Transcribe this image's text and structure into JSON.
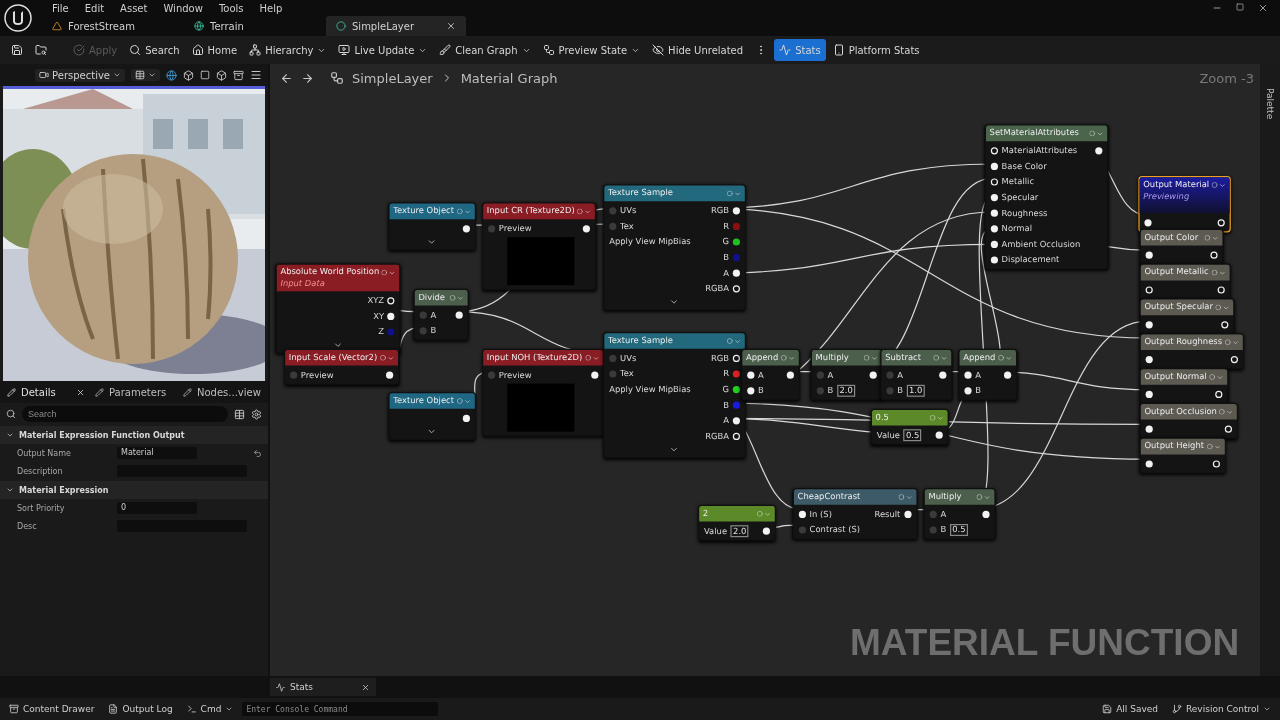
{
  "menu": [
    "File",
    "Edit",
    "Asset",
    "Window",
    "Tools",
    "Help"
  ],
  "tabs": [
    {
      "label": "ForestStream",
      "kind": "level",
      "selected": false
    },
    {
      "label": "Terrain",
      "kind": "landscape",
      "selected": false
    },
    {
      "label": "SimpleLayer",
      "kind": "material",
      "selected": true
    }
  ],
  "toolbar": [
    {
      "kind": "save",
      "disabled": false,
      "selected": false,
      "dropdown": false
    },
    {
      "kind": "browse",
      "disabled": false,
      "selected": false,
      "dropdown": false
    },
    {
      "kind": "apply",
      "label": "Apply",
      "disabled": true,
      "selected": false,
      "dropdown": false
    },
    {
      "kind": "search",
      "label": "Search",
      "disabled": false,
      "selected": false,
      "dropdown": false
    },
    {
      "kind": "home",
      "label": "Home",
      "disabled": false,
      "selected": false,
      "dropdown": false
    },
    {
      "kind": "hierarchy",
      "label": "Hierarchy",
      "disabled": false,
      "selected": false,
      "dropdown": true
    },
    {
      "kind": "live",
      "label": "Live Update",
      "disabled": false,
      "selected": false,
      "dropdown": true
    },
    {
      "kind": "clean",
      "label": "Clean Graph",
      "disabled": false,
      "selected": false,
      "dropdown": true
    },
    {
      "kind": "preview",
      "label": "Preview State",
      "disabled": false,
      "selected": false,
      "dropdown": true
    },
    {
      "kind": "hide",
      "label": "Hide Unrelated",
      "disabled": false,
      "selected": false,
      "dropdown": false
    },
    {
      "kind": "more",
      "disabled": false,
      "selected": false,
      "dropdown": false
    },
    {
      "kind": "stats",
      "label": "Stats",
      "disabled": false,
      "selected": true,
      "dropdown": false
    },
    {
      "kind": "platform",
      "label": "Platform Stats",
      "disabled": false,
      "selected": false,
      "dropdown": false
    }
  ],
  "viewport": {
    "mode": "Perspective"
  },
  "panel_tabs": [
    {
      "label": "Details",
      "selected": true,
      "closable": true
    },
    {
      "label": "Parameters",
      "selected": false,
      "closable": false
    },
    {
      "label": "Nodes...view",
      "selected": false,
      "closable": false
    }
  ],
  "details_search": {
    "placeholder": "Search"
  },
  "sections": [
    {
      "title": "Material Expression Function Output",
      "expanded": true,
      "rows": [
        {
          "label": "Output Name",
          "value": "Material",
          "resettable": true
        },
        {
          "label": "Description",
          "resettable": false
        }
      ]
    },
    {
      "title": "Material Expression",
      "expanded": true,
      "rows": [
        {
          "label": "Sort Priority",
          "value": "0",
          "resettable": false
        },
        {
          "label": "Desc",
          "resettable": false
        }
      ]
    }
  ],
  "breadcrumb": [
    "SimpleLayer",
    "Material Graph"
  ],
  "zoom": "Zoom -3",
  "palette": "Palette",
  "nodes": [
    {
      "title": "Texture Object",
      "kind": "texture",
      "selected": false,
      "preview": false,
      "more_pins": true,
      "outputs": [
        {
          "kind": "filled"
        }
      ]
    },
    {
      "title": "Input CR (Texture2D)",
      "kind": "param",
      "selected": false,
      "preview": true,
      "more_pins": false,
      "inputs": [
        {
          "label": "Preview",
          "kind": "dim"
        }
      ],
      "outputs": [
        {
          "kind": "filled"
        }
      ]
    },
    {
      "title": "Texture Sample",
      "kind": "sample",
      "selected": false,
      "preview": false,
      "more_pins": true,
      "inputs": [
        {
          "label": "UVs",
          "kind": "dim"
        },
        {
          "label": "Tex",
          "kind": "dim"
        },
        {
          "label": "Apply View MipBias",
          "kind": "none"
        }
      ],
      "outputs": [
        {
          "label": "RGB",
          "kind": "filled"
        },
        {
          "label": "R",
          "kind": "filled",
          "color": "#8a1010"
        },
        {
          "label": "G",
          "kind": "filled",
          "color": "#20c020"
        },
        {
          "label": "B",
          "kind": "filled",
          "color": "#10108a"
        },
        {
          "label": "A",
          "kind": "filled"
        },
        {
          "label": "RGBA",
          "kind": "ring"
        }
      ]
    },
    {
      "title": "Absolute World Position",
      "subtitle": "Input Data",
      "kind": "param",
      "selected": false,
      "preview": false,
      "more_pins": true,
      "outputs": [
        {
          "label": "XYZ",
          "kind": "ring"
        },
        {
          "label": "XY",
          "kind": "filled"
        },
        {
          "label": "Z",
          "kind": "filled",
          "color": "#10108a"
        }
      ]
    },
    {
      "title": "Divide",
      "kind": "math",
      "selected": false,
      "preview": false,
      "more_pins": false,
      "inputs": [
        {
          "label": "A",
          "kind": "dim"
        },
        {
          "label": "B",
          "kind": "dim"
        }
      ],
      "outputs": [
        {
          "kind": "filled"
        }
      ]
    },
    {
      "title": "Input Scale (Vector2)",
      "kind": "param",
      "selected": false,
      "preview": false,
      "more_pins": false,
      "inputs": [
        {
          "label": "Preview",
          "kind": "dim"
        }
      ],
      "outputs": [
        {
          "kind": "filled"
        }
      ]
    },
    {
      "title": "Input NOH (Texture2D)",
      "kind": "param",
      "selected": false,
      "preview": true,
      "more_pins": false,
      "inputs": [
        {
          "label": "Preview",
          "kind": "dim"
        }
      ],
      "outputs": [
        {
          "kind": "filled"
        }
      ]
    },
    {
      "title": "Texture Object",
      "kind": "texture",
      "selected": false,
      "preview": false,
      "more_pins": true,
      "outputs": [
        {
          "kind": "filled"
        }
      ]
    },
    {
      "title": "Texture Sample",
      "kind": "sample",
      "selected": false,
      "preview": false,
      "more_pins": true,
      "inputs": [
        {
          "label": "UVs",
          "kind": "dim"
        },
        {
          "label": "Tex",
          "kind": "dim"
        },
        {
          "label": "Apply View MipBias",
          "kind": "none"
        }
      ],
      "outputs": [
        {
          "label": "RGB",
          "kind": "ring"
        },
        {
          "label": "R",
          "kind": "filled",
          "color": "#e02020"
        },
        {
          "label": "G",
          "kind": "filled",
          "color": "#20d020"
        },
        {
          "label": "B",
          "kind": "filled",
          "color": "#1a1ae0"
        },
        {
          "label": "A",
          "kind": "filled"
        },
        {
          "label": "RGBA",
          "kind": "ring"
        }
      ]
    },
    {
      "title": "Append",
      "kind": "math",
      "selected": false,
      "preview": false,
      "more_pins": false,
      "inputs": [
        {
          "label": "A",
          "kind": "filled"
        },
        {
          "label": "B",
          "kind": "filled"
        }
      ],
      "outputs": [
        {
          "kind": "filled"
        }
      ]
    },
    {
      "title": "Multiply",
      "kind": "math",
      "selected": false,
      "preview": false,
      "more_pins": false,
      "inputs": [
        {
          "label": "A",
          "kind": "dim"
        },
        {
          "label": "B",
          "kind": "dim",
          "value": "2.0"
        }
      ],
      "outputs": [
        {
          "kind": "filled"
        }
      ]
    },
    {
      "title": "Subtract",
      "kind": "math",
      "selected": false,
      "preview": false,
      "more_pins": false,
      "inputs": [
        {
          "label": "A",
          "kind": "dim"
        },
        {
          "label": "B",
          "kind": "dim",
          "value": "1.0"
        }
      ],
      "outputs": [
        {
          "kind": "filled"
        }
      ]
    },
    {
      "title": "Append",
      "kind": "math",
      "selected": false,
      "preview": false,
      "more_pins": false,
      "inputs": [
        {
          "label": "A",
          "kind": "filled"
        },
        {
          "label": "B",
          "kind": "filled"
        }
      ],
      "outputs": [
        {
          "kind": "filled"
        }
      ]
    },
    {
      "title": "0.5",
      "kind": "constant",
      "selected": false,
      "preview": false,
      "more_pins": false,
      "inputs": [
        {
          "label": "Value",
          "kind": "none",
          "value": "0.5"
        }
      ],
      "outputs": [
        {
          "kind": "filled"
        }
      ]
    },
    {
      "title": "2",
      "kind": "constant",
      "selected": false,
      "preview": false,
      "more_pins": false,
      "inputs": [
        {
          "label": "Value",
          "kind": "none",
          "value": "2.0"
        }
      ],
      "outputs": [
        {
          "kind": "filled"
        }
      ]
    },
    {
      "title": "CheapContrast",
      "kind": "function",
      "selected": false,
      "preview": false,
      "more_pins": false,
      "inputs": [
        {
          "label": "In (S)",
          "kind": "filled"
        },
        {
          "label": "Contrast (S)",
          "kind": "dim"
        }
      ],
      "outputs": [
        {
          "label": "Result",
          "kind": "filled"
        }
      ]
    },
    {
      "title": "Multiply",
      "kind": "math",
      "selected": false,
      "preview": false,
      "more_pins": false,
      "inputs": [
        {
          "label": "A",
          "kind": "dim"
        },
        {
          "label": "B",
          "kind": "dim",
          "value": "0.5"
        }
      ],
      "outputs": [
        {
          "kind": "filled"
        }
      ]
    },
    {
      "title": "SetMaterialAttributes",
      "kind": "attributes",
      "selected": false,
      "preview": false,
      "more_pins": false,
      "inputs": [
        {
          "label": "MaterialAttributes",
          "kind": "ring"
        },
        {
          "label": "Base Color",
          "kind": "filled"
        },
        {
          "label": "Metallic",
          "kind": "ring"
        },
        {
          "label": "Specular",
          "kind": "filled"
        },
        {
          "label": "Roughness",
          "kind": "filled"
        },
        {
          "label": "Normal",
          "kind": "filled"
        },
        {
          "label": "Ambient Occlusion",
          "kind": "filled"
        },
        {
          "label": "Displacement",
          "kind": "filled"
        }
      ],
      "outputs": [
        {
          "kind": "filled"
        }
      ]
    },
    {
      "title": "Output Material",
      "subtitle": "Previewing",
      "kind": "result",
      "selected": true,
      "preview": false,
      "more_pins": false,
      "inputs": [
        {
          "kind": "filled"
        }
      ],
      "outputs": [
        {
          "kind": "ring"
        }
      ]
    },
    {
      "title": "Output Color",
      "kind": "output",
      "selected": false,
      "preview": false,
      "more_pins": false,
      "inputs": [
        {
          "kind": "filled"
        }
      ],
      "outputs": [
        {
          "kind": "ring"
        }
      ]
    },
    {
      "title": "Output Metallic",
      "kind": "output",
      "selected": false,
      "preview": false,
      "more_pins": false,
      "inputs": [
        {
          "kind": "ring"
        }
      ],
      "outputs": [
        {
          "kind": "ring"
        }
      ]
    },
    {
      "title": "Output Specular",
      "kind": "output",
      "selected": false,
      "preview": false,
      "more_pins": false,
      "inputs": [
        {
          "kind": "filled"
        }
      ],
      "outputs": [
        {
          "kind": "ring"
        }
      ]
    },
    {
      "title": "Output Roughness",
      "kind": "output",
      "selected": false,
      "preview": false,
      "more_pins": false,
      "inputs": [
        {
          "kind": "filled"
        }
      ],
      "outputs": [
        {
          "kind": "ring"
        }
      ]
    },
    {
      "title": "Output Normal",
      "kind": "output",
      "selected": false,
      "preview": false,
      "more_pins": false,
      "inputs": [
        {
          "kind": "filled"
        }
      ],
      "outputs": [
        {
          "kind": "ring"
        }
      ]
    },
    {
      "title": "Output Occlusion",
      "kind": "output",
      "selected": false,
      "preview": false,
      "more_pins": false,
      "inputs": [
        {
          "kind": "filled"
        }
      ],
      "outputs": [
        {
          "kind": "ring"
        }
      ]
    },
    {
      "title": "Output Height",
      "kind": "output",
      "selected": false,
      "preview": false,
      "more_pins": false,
      "inputs": [
        {
          "kind": "filled"
        }
      ],
      "outputs": [
        {
          "kind": "ring"
        }
      ]
    }
  ],
  "caption": "MATERIAL FUNCTION",
  "bottom_tab": {
    "label": "Stats"
  },
  "status_bar": {
    "left": [
      {
        "kind": "drawer",
        "label": "Content Drawer"
      },
      {
        "kind": "log",
        "label": "Output Log"
      },
      {
        "kind": "cmd",
        "label": "Cmd"
      }
    ],
    "console": {
      "placeholder": "Enter Console Command"
    },
    "right": [
      {
        "kind": "saved",
        "label": "All Saved"
      },
      {
        "kind": "revision",
        "label": "Revision Control"
      }
    ]
  }
}
